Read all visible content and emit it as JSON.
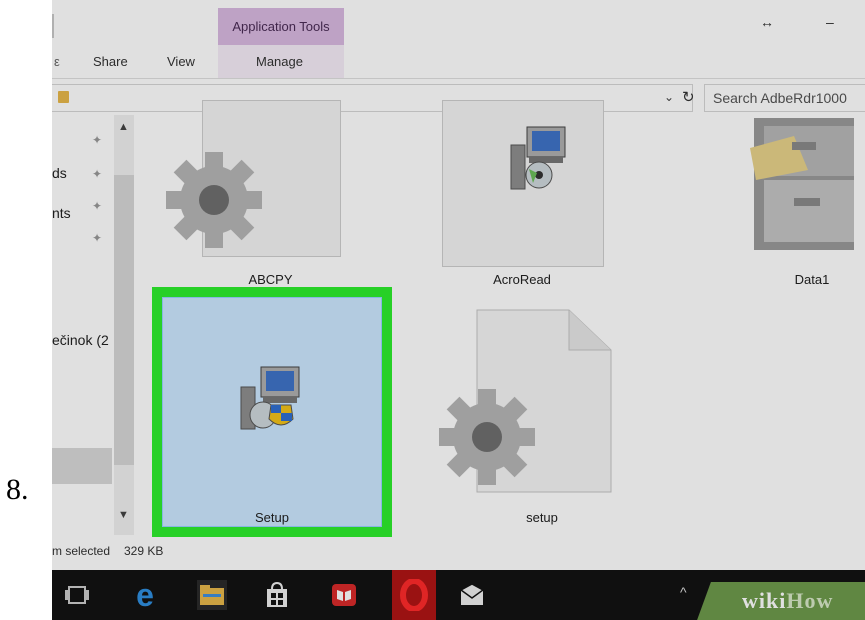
{
  "step_number": "8.",
  "ribbon": {
    "contextual_header": "Application Tools",
    "tabs": [
      "Share",
      "View",
      "Manage"
    ],
    "window_restore_glyph": "↔",
    "window_minimize_glyph": "–"
  },
  "address_bar": {
    "chevron": "⌄",
    "refresh_glyph": "↻",
    "search_placeholder": "Search AdbeRdr1000"
  },
  "navigation_pane": {
    "items": [
      "ds",
      "nts",
      "ečinok (2"
    ]
  },
  "files": [
    {
      "name": "ABCPY",
      "icon": "gear-icon"
    },
    {
      "name": "AcroRead",
      "icon": "installer-icon"
    },
    {
      "name": "Data1",
      "icon": "filing-cabinet-icon"
    },
    {
      "name": "Setup",
      "icon": "setup-installer-icon",
      "selected": true
    },
    {
      "name": "setup",
      "icon": "gear-file-icon"
    }
  ],
  "status_bar": {
    "selection": "m selected",
    "size": "329 KB"
  },
  "taskbar": {
    "icons": [
      "task-view-icon",
      "edge-icon",
      "file-explorer-icon",
      "store-icon",
      "reader-icon",
      "opera-icon",
      "mail-icon"
    ],
    "tray_chevron": "^"
  },
  "watermark": {
    "prefix": "wiki",
    "suffix": "How"
  },
  "colors": {
    "selection_highlight": "#2ded2d",
    "selected_fill": "#cce8ff",
    "contextual_tab": "#d9b9e1",
    "taskbar": "#131313"
  }
}
